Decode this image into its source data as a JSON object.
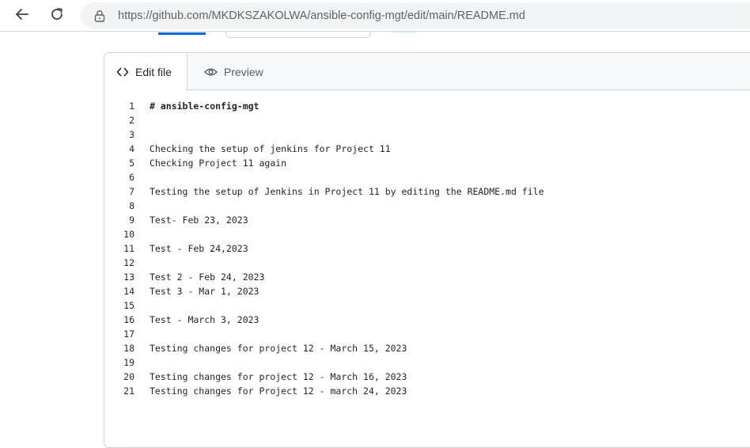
{
  "browser": {
    "url_origin": "https://github.com/",
    "url_path": "MKDKSZAKOLWA/ansible-config-mgt/edit/main/README.md",
    "icons": [
      "back-arrow-icon",
      "reload-icon",
      "lock-icon"
    ]
  },
  "editor": {
    "tabs": {
      "edit_label": "Edit file",
      "preview_label": "Preview"
    },
    "lines": [
      {
        "n": "1",
        "text": "# ansible-config-mgt"
      },
      {
        "n": "2",
        "text": ""
      },
      {
        "n": "3",
        "text": ""
      },
      {
        "n": "4",
        "text": "Checking the setup of jenkins for Project 11"
      },
      {
        "n": "5",
        "text": "Checking Project 11 again"
      },
      {
        "n": "6",
        "text": ""
      },
      {
        "n": "7",
        "text": "Testing the setup of Jenkins in Project 11 by editing the README.md file"
      },
      {
        "n": "8",
        "text": ""
      },
      {
        "n": "9",
        "text": "Test- Feb 23, 2023"
      },
      {
        "n": "10",
        "text": ""
      },
      {
        "n": "11",
        "text": "Test - Feb 24,2023"
      },
      {
        "n": "12",
        "text": ""
      },
      {
        "n": "13",
        "text": "Test 2 - Feb 24, 2023"
      },
      {
        "n": "14",
        "text": "Test 3 - Mar 1, 2023"
      },
      {
        "n": "15",
        "text": ""
      },
      {
        "n": "16",
        "text": "Test - March 3, 2023"
      },
      {
        "n": "17",
        "text": ""
      },
      {
        "n": "18",
        "text": "Testing changes for project 12 - March 15, 2023"
      },
      {
        "n": "19",
        "text": ""
      },
      {
        "n": "20",
        "text": "Testing changes for project 12 - March 16, 2023"
      },
      {
        "n": "21",
        "text": "Testing changes for Project 12 - march 24, 2023"
      }
    ]
  },
  "colors": {
    "accent": "#0969da",
    "border": "#d0d7de",
    "tab_bg": "#f6f8fa"
  }
}
